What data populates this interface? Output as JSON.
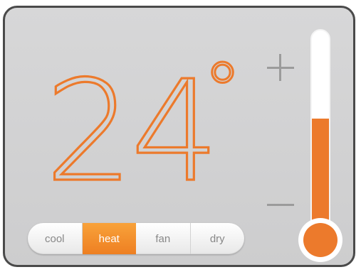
{
  "thermostat": {
    "temperature": "24",
    "degree_symbol": "°",
    "level": 0.58,
    "accent_color": "#ec7a2c",
    "increase_icon": "plus-icon",
    "decrease_icon": "minus-icon",
    "modes": [
      {
        "label": "cool",
        "active": false
      },
      {
        "label": "heat",
        "active": true
      },
      {
        "label": "fan",
        "active": false
      },
      {
        "label": "dry",
        "active": false
      }
    ]
  }
}
